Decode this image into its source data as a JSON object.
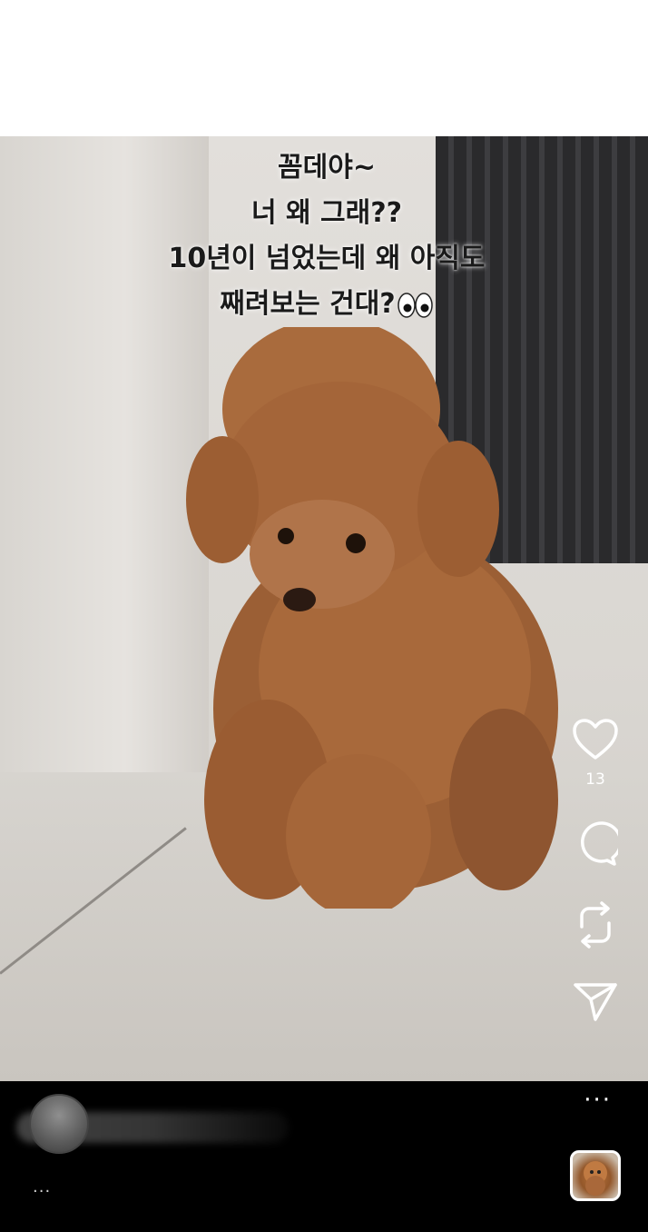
{
  "caption": {
    "lines": [
      "꼼데야~",
      "너 왜 그래??",
      "10년이 넘었는데 왜 아직도",
      "째려보는 건대?"
    ],
    "emoji": "eyes-icon"
  },
  "actions": {
    "like_icon": "heart-icon",
    "like_count": "13",
    "comment_icon": "comment-bubble-icon",
    "repost_icon": "repost-arrows-icon",
    "share_icon": "send-paper-plane-icon"
  },
  "bottom": {
    "more_top": "···",
    "more_bottom": "..."
  },
  "colors": {
    "bar_background": "#000000",
    "icon_color": "#ffffff"
  }
}
